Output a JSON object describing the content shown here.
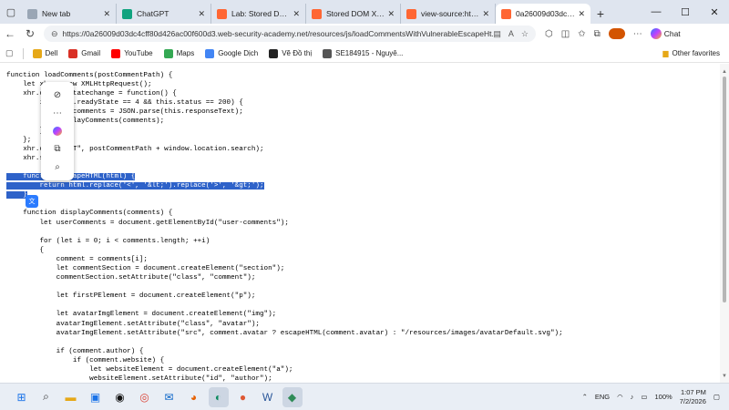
{
  "tabs": [
    {
      "title": "New tab",
      "icon": "page-icon",
      "active": false
    },
    {
      "title": "ChatGPT",
      "icon": "chatgpt-icon",
      "active": false
    },
    {
      "title": "Lab: Stored DOM XSS",
      "icon": "portswigger-icon",
      "active": false
    },
    {
      "title": "Stored DOM XSS",
      "icon": "portswigger-icon",
      "active": false
    },
    {
      "title": "view-source:https://0a",
      "icon": "portswigger-icon",
      "active": false
    },
    {
      "title": "0a26009d03dc4cff80d",
      "icon": "portswigger-icon",
      "active": true
    }
  ],
  "address": {
    "url": "https://0a26009d03dc4cff80d426ac00f600d3.web-security-academy.net/resources/js/loadCommentsWithVulnerableEscapeHt..."
  },
  "toolbar": {
    "chat_label": "Chat"
  },
  "bookmarks": [
    {
      "label": "Dell",
      "icon": "folder-icon",
      "color": "#e6a817"
    },
    {
      "label": "Gmail",
      "icon": "gmail-icon",
      "color": "#d93025"
    },
    {
      "label": "YouTube",
      "icon": "youtube-icon",
      "color": "#ff0000"
    },
    {
      "label": "Maps",
      "icon": "maps-icon",
      "color": "#34a853"
    },
    {
      "label": "Google Dịch",
      "icon": "translate-icon",
      "color": "#4285f4"
    },
    {
      "label": "Vẽ Đồ thị",
      "icon": "graph-icon",
      "color": "#222222"
    },
    {
      "label": "SE184915 - Nguyê...",
      "icon": "globe-icon",
      "color": "#555555"
    }
  ],
  "other_favorites": "Other favorites",
  "code_lines": [
    "function loadComments(postCommentPath) {",
    "    let xhr = new XMLHttpRequest();",
    "    xhr.onreadystatechange = function() {",
    "        if (this.readyState == 4 && this.status == 200) {",
    "            let comments = JSON.parse(this.responseText);",
    "            displayComments(comments);",
    "        }",
    "    };",
    "    xhr.open(\"GET\", postCommentPath + window.location.search);",
    "    xhr.send();",
    "",
    "    function escapeHTML(html) {",
    "        return html.replace('<', '&lt;').replace('>', '&gt;');",
    "    }",
    "",
    "    function displayComments(comments) {",
    "        let userComments = document.getElementById(\"user-comments\");",
    "",
    "        for (let i = 0; i < comments.length; ++i)",
    "        {",
    "            comment = comments[i];",
    "            let commentSection = document.createElement(\"section\");",
    "            commentSection.setAttribute(\"class\", \"comment\");",
    "",
    "            let firstPElement = document.createElement(\"p\");",
    "",
    "            let avatarImgElement = document.createElement(\"img\");",
    "            avatarImgElement.setAttribute(\"class\", \"avatar\");",
    "            avatarImgElement.setAttribute(\"src\", comment.avatar ? escapeHTML(comment.avatar) : \"/resources/images/avatarDefault.svg\");",
    "",
    "            if (comment.author) {",
    "                if (comment.website) {",
    "                    let websiteElement = document.createElement(\"a\");",
    "                    websiteElement.setAttribute(\"id\", \"author\");",
    "                    websiteElement.setAttribute(\"href\", comment.website);",
    "                    firstPElement.appendChild(websiteElement)"
  ],
  "selected_lines": [
    11,
    12,
    13
  ],
  "taskbar": {
    "apps": [
      "windows-start-icon",
      "search-icon",
      "file-explorer-icon",
      "store-icon",
      "dell-icon",
      "chrome-icon",
      "outlook-icon",
      "firefox-icon",
      "edge-icon",
      "duckduckgo-icon",
      "word-icon",
      "app-icon"
    ],
    "language": "ENG",
    "battery": "100%",
    "time": "1:07 PM",
    "date": "7/2/2026"
  }
}
